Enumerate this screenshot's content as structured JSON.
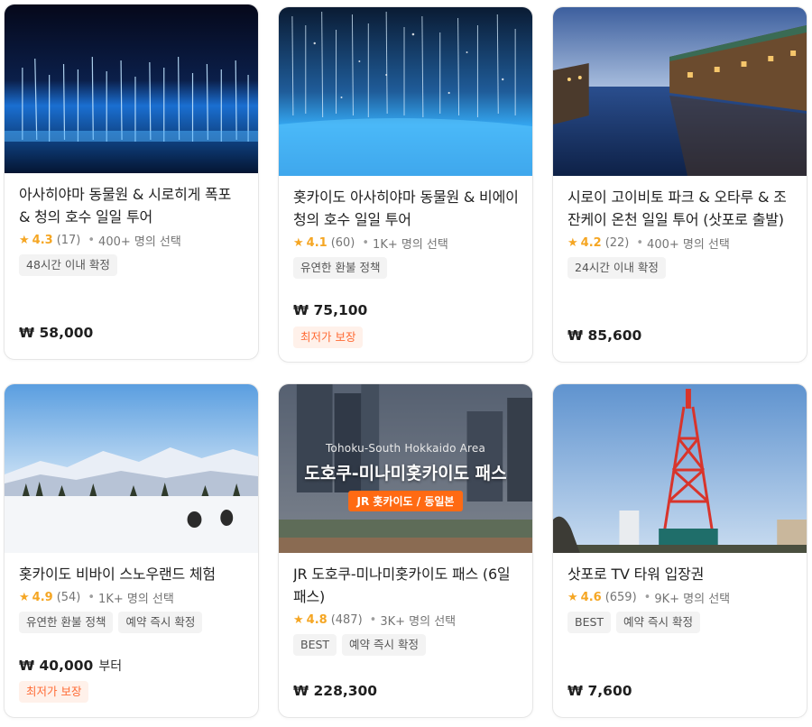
{
  "colors": {
    "star": "#f5a623",
    "lowest_price_text": "#ff6b35",
    "lowest_price_bg": "#fff1ea",
    "tag_bg": "#f3f3f3"
  },
  "cards": [
    {
      "title": "아사히야마 동물원 & 시로히게 폭포 & 청의 호수 일일 투어",
      "image": "blue-pond-night",
      "star_icon": "★",
      "rating": "4.3",
      "reviews": "(17)",
      "dot": "•",
      "selected": "400+ 명의 선택",
      "tags": [
        "48시간 이내 확정"
      ],
      "price": "₩ 58,000",
      "price_suffix": "",
      "lowest_badge": ""
    },
    {
      "title": "홋카이도 아사히야마 동물원 & 비에이 청의 호수 일일 투어",
      "image": "blue-pond-snow",
      "star_icon": "★",
      "rating": "4.1",
      "reviews": "(60)",
      "dot": "•",
      "selected": "1K+ 명의 선택",
      "tags": [
        "유연한 환불 정책"
      ],
      "price": "₩ 75,100",
      "price_suffix": "",
      "lowest_badge": "최저가 보장"
    },
    {
      "title": "시로이 고이비토 파크 & 오타루 & 조잔케이 온천 일일 투어 (삿포로 출발)",
      "image": "otaru-canal",
      "star_icon": "★",
      "rating": "4.2",
      "reviews": "(22)",
      "dot": "•",
      "selected": "400+ 명의 선택",
      "tags": [
        "24시간 이내 확정"
      ],
      "price": "₩ 85,600",
      "price_suffix": "",
      "lowest_badge": ""
    },
    {
      "title": "홋카이도 비바이 스노우랜드 체험",
      "image": "snowland",
      "star_icon": "★",
      "rating": "4.9",
      "reviews": "(54)",
      "dot": "•",
      "selected": "1K+ 명의 선택",
      "tags": [
        "유연한 환불 정책",
        "예약 즉시 확정"
      ],
      "price": "₩ 40,000",
      "price_suffix": "부터",
      "lowest_badge": "최저가 보장"
    },
    {
      "title": "JR 도호쿠-미나미홋카이도 패스 (6일 패스)",
      "image": "jr-pass",
      "image_sub": "Tohoku-South Hokkaido Area",
      "image_main": "도호쿠-미나미홋카이도 패스",
      "image_badge": "JR 홋카이도 / 동일본",
      "star_icon": "★",
      "rating": "4.8",
      "reviews": "(487)",
      "dot": "•",
      "selected": "3K+ 명의 선택",
      "tags": [
        "BEST",
        "예약 즉시 확정"
      ],
      "price": "₩ 228,300",
      "price_suffix": "",
      "lowest_badge": ""
    },
    {
      "title": "삿포로 TV 타워 입장권",
      "image": "tv-tower",
      "star_icon": "★",
      "rating": "4.6",
      "reviews": "(659)",
      "dot": "•",
      "selected": "9K+ 명의 선택",
      "tags": [
        "BEST",
        "예약 즉시 확정"
      ],
      "price": "₩ 7,600",
      "price_suffix": "",
      "lowest_badge": ""
    }
  ]
}
